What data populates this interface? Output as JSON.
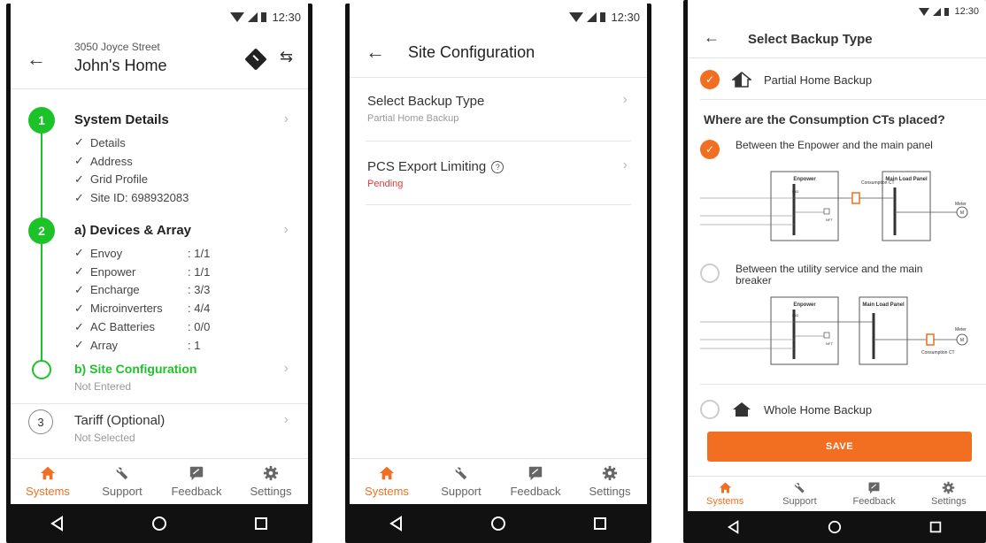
{
  "status": {
    "time": "12:30"
  },
  "tabs": [
    {
      "label": "Systems",
      "icon": "home-icon"
    },
    {
      "label": "Support",
      "icon": "wrench-icon"
    },
    {
      "label": "Feedback",
      "icon": "feedback-icon"
    },
    {
      "label": "Settings",
      "icon": "gear-icon"
    }
  ],
  "screen1": {
    "address": "3050 Joyce Street",
    "title": "John's Home",
    "steps": [
      {
        "number": "1",
        "title": "System Details",
        "items": [
          "Details",
          "Address",
          "Grid Profile",
          "Site ID: 698932083"
        ]
      },
      {
        "number": "2",
        "title": "a) Devices & Array",
        "items": [
          {
            "label": "Envoy",
            "value": ": 1/1"
          },
          {
            "label": "Enpower",
            "value": ": 1/1"
          },
          {
            "label": "Encharge",
            "value": ": 3/3"
          },
          {
            "label": "Microinverters",
            "value": ": 4/4"
          },
          {
            "label": "AC Batteries",
            "value": ": 0/0"
          },
          {
            "label": "Array",
            "value": ": 1"
          }
        ]
      },
      {
        "title": "b) Site Configuration",
        "status": "Not Entered"
      },
      {
        "number": "3",
        "title": "Tariff (Optional)",
        "status": "Not Selected"
      }
    ]
  },
  "screen2": {
    "title": "Site Configuration",
    "items": [
      {
        "label": "Select Backup Type",
        "value": "Partial Home Backup"
      },
      {
        "label": "PCS Export Limiting",
        "value": "Pending"
      }
    ]
  },
  "screen3": {
    "title": "Select Backup Type",
    "option_partial": "Partial Home Backup",
    "question": "Where are the Consumption CTs placed?",
    "ct_option1": "Between the Enpower and the main panel",
    "ct_option2": "Between the utility service and the main breaker",
    "option_whole": "Whole Home Backup",
    "save": "SAVE",
    "diagram": {
      "enpower": "Enpower",
      "main_load_panel": "Main Load Panel",
      "consumption_ct": "Consumption CT",
      "meter": "Meter",
      "mid": "MID",
      "nft": "NFT",
      "m": "M"
    }
  },
  "colors": {
    "green": "#1dc229",
    "orange": "#f26f21",
    "red": "#e53935"
  }
}
